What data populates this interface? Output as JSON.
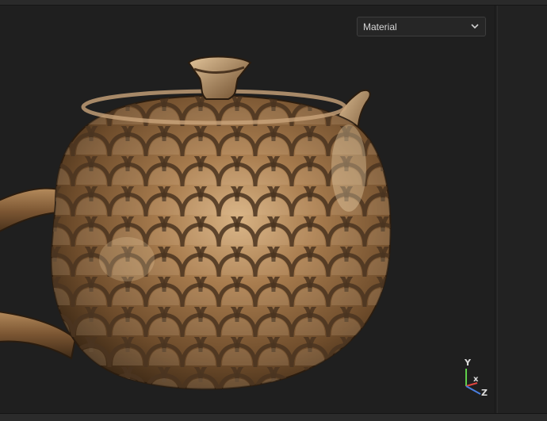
{
  "viewport": {
    "shading_mode": {
      "selected": "Material"
    },
    "gizmo": {
      "y": "Y",
      "x": "x",
      "z": "Z"
    }
  },
  "colors": {
    "background": "#1f1f1f",
    "bronze_light": "#c9a47a",
    "bronze_mid": "#8b633c",
    "bronze_dark": "#3d2a18",
    "axis_y": "#5fcf4a",
    "axis_x": "#e0453f",
    "axis_z": "#4a7fe0"
  },
  "icons": {
    "dropdown": "chevron-down-icon",
    "gizmo": "axis-gizmo-icon"
  }
}
